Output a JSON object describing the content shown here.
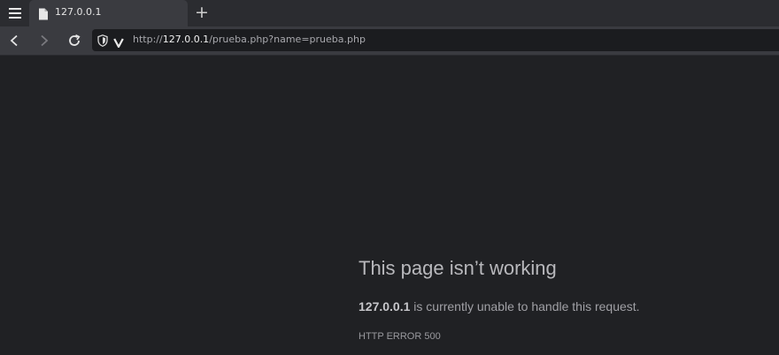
{
  "browser": {
    "menu_icon": "hamburger-menu-icon",
    "tabs": [
      {
        "title": "127.0.0.1",
        "icon": "document-icon"
      }
    ],
    "new_tab_label": "+",
    "toolbar": {
      "back_icon": "chevron-left-icon",
      "forward_icon": "chevron-right-icon",
      "reload_icon": "reload-icon",
      "address": {
        "scheme": "http://",
        "host": "127.0.0.1",
        "path": "/prueba.php?name=prueba.php"
      }
    }
  },
  "error_page": {
    "title": "This page isn’t working",
    "host": "127.0.0.1",
    "message": " is currently unable to handle this request.",
    "code": "HTTP ERROR 500"
  },
  "colors": {
    "page_background": "#202124",
    "tabstrip": "#2b2c30",
    "toolbar": "#3a3b40",
    "url_field": "#1b1c1f"
  }
}
